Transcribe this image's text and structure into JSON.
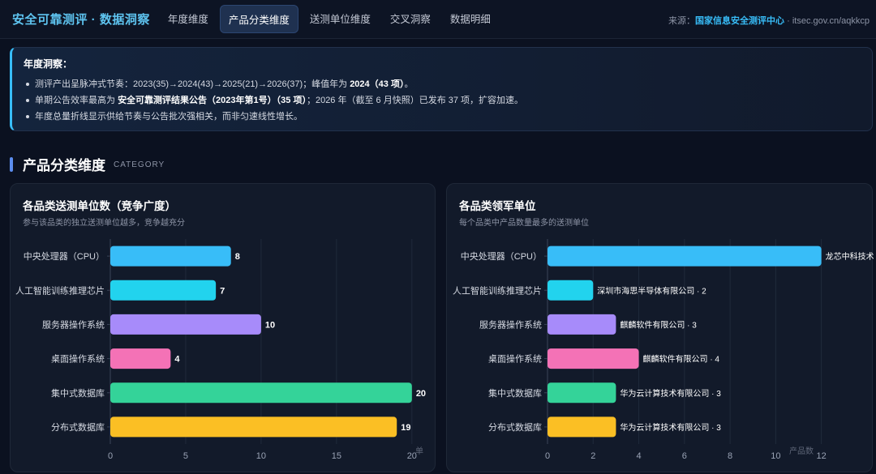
{
  "header": {
    "brand": "安全可靠测评 · 数据洞察",
    "tabs": [
      {
        "label": "年度维度",
        "active": false
      },
      {
        "label": "产品分类维度",
        "active": true
      },
      {
        "label": "送测单位维度",
        "active": false
      },
      {
        "label": "交叉洞察",
        "active": false
      },
      {
        "label": "数据明细",
        "active": false
      }
    ],
    "source_prefix": "来源：",
    "source_name": "国家信息安全测评中心",
    "source_url": " · itsec.gov.cn/aqkkcp"
  },
  "insight": {
    "title": "年度洞察：",
    "line1_text": "测评产出呈脉冲式节奏：2023(35)→2024(43)→2025(21)→2026(37)；峰值年为 ",
    "line1_bold": "2024（43 项）",
    "line1_end": "。",
    "line2_text": "单期公告效率最高为 ",
    "line2_bold": "安全可靠测评结果公告（2023年第1号）（35 项）",
    "line2_end": "；2026 年（截至 6 月快照）已发布 37 项，扩容加速。",
    "line3": "年度总量折线显示供给节奏与公告批次强相关，而非匀速线性增长。"
  },
  "section": {
    "title": "产品分类维度",
    "subtitle": "CATEGORY"
  },
  "left_panel": {
    "title": "各品类送测单位数（竞争广度）",
    "subtitle": "参与该品类的独立送测单位越多，竞争越充分"
  },
  "right_panel": {
    "title": "各品类领军单位",
    "subtitle": "每个品类中产品数量最多的送测单位"
  },
  "colors": {
    "bars": [
      "#38bdf8",
      "#22d3ee",
      "#a78bfa",
      "#f472b6",
      "#34d399",
      "#fbbf24"
    ]
  },
  "chart_data": [
    {
      "type": "bar",
      "orientation": "horizontal",
      "categories": [
        "中央处理器（CPU）",
        "人工智能训练推理芯片",
        "服务器操作系统",
        "桌面操作系统",
        "集中式数据库",
        "分布式数据库"
      ],
      "values": [
        8,
        7,
        10,
        4,
        20,
        19
      ],
      "value_labels": [
        "8",
        "7",
        "10",
        "4",
        "20",
        "19"
      ],
      "xlim": [
        0,
        22
      ],
      "xticks": [
        0,
        5,
        10,
        15,
        20
      ],
      "xlabel": "单",
      "grid": true
    },
    {
      "type": "bar",
      "orientation": "horizontal",
      "categories": [
        "中央处理器（CPU）",
        "人工智能训练推理芯片",
        "服务器操作系统",
        "桌面操作系统",
        "集中式数据库",
        "分布式数据库"
      ],
      "values": [
        12,
        2,
        3,
        4,
        3,
        3
      ],
      "value_labels": [
        "龙芯中科技术股份有限公",
        "深圳市海思半导体有限公司 · 2",
        "麒麟软件有限公司 · 3",
        "麒麟软件有限公司 · 4",
        "华为云计算技术有限公司 · 3",
        "华为云计算技术有限公司 · 3"
      ],
      "xlim": [
        0,
        14.5
      ],
      "xticks": [
        0,
        2,
        4,
        6,
        8,
        10,
        12
      ],
      "xlabel": "产品数",
      "grid": true
    }
  ]
}
